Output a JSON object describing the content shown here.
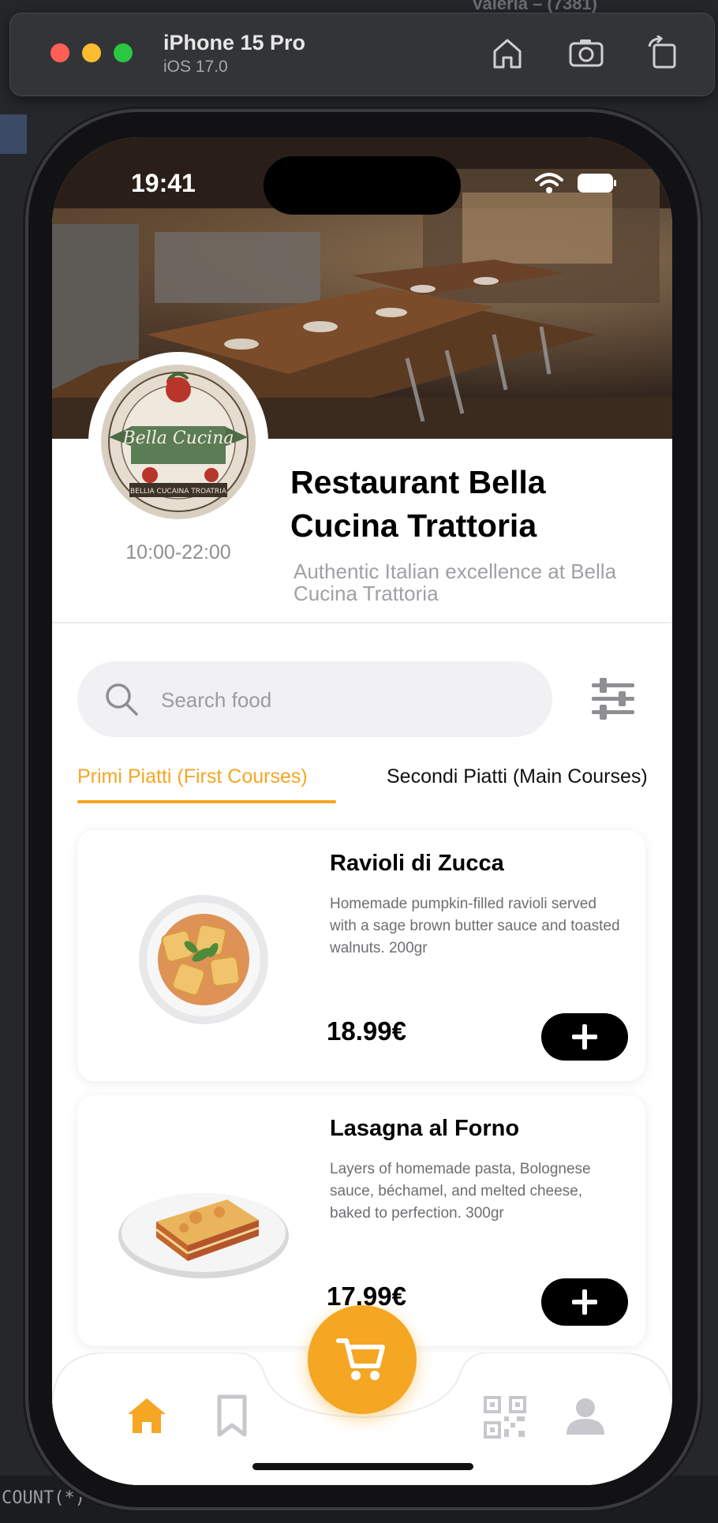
{
  "background": {
    "top_text": "Valeria – (7381)",
    "bottom_text": "COUNT(*)"
  },
  "simulator": {
    "device": "iPhone 15 Pro",
    "os": "iOS 17.0",
    "icons": [
      "home-icon",
      "screenshot-icon",
      "rotate-icon"
    ]
  },
  "status_bar": {
    "time": "19:41"
  },
  "restaurant": {
    "name": "Restaurant Bella Cucina Trattoria",
    "description": "Authentic Italian excellence at Bella Cucina Trattoria",
    "hours": "10:00-22:00",
    "logo_text": "Bella Cucina",
    "logo_subtext": "BELLIA CUCAINA TROATRIA"
  },
  "search": {
    "placeholder": "Search food"
  },
  "tabs": [
    {
      "label": "Primi Piatti (First Courses)",
      "active": true
    },
    {
      "label": "Secondi Piatti (Main Courses)",
      "active": false
    }
  ],
  "menu_items": [
    {
      "name": "Ravioli di Zucca",
      "description": "Homemade pumpkin-filled ravioli served with a sage brown butter sauce and toasted walnuts. 200gr",
      "price": "18.99€"
    },
    {
      "name": "Lasagna al Forno",
      "description": "Layers of homemade pasta, Bolognese sauce, béchamel, and melted cheese, baked to perfection. 300gr",
      "price": "17.99€"
    }
  ],
  "nav": {
    "items": [
      "home-icon",
      "bookmark-icon",
      "cart-icon",
      "qr-code-icon",
      "profile-icon"
    ],
    "active": "home-icon"
  },
  "colors": {
    "accent": "#f5a623",
    "text": "#000000",
    "muted": "#8e8e93",
    "button": "#000000"
  }
}
